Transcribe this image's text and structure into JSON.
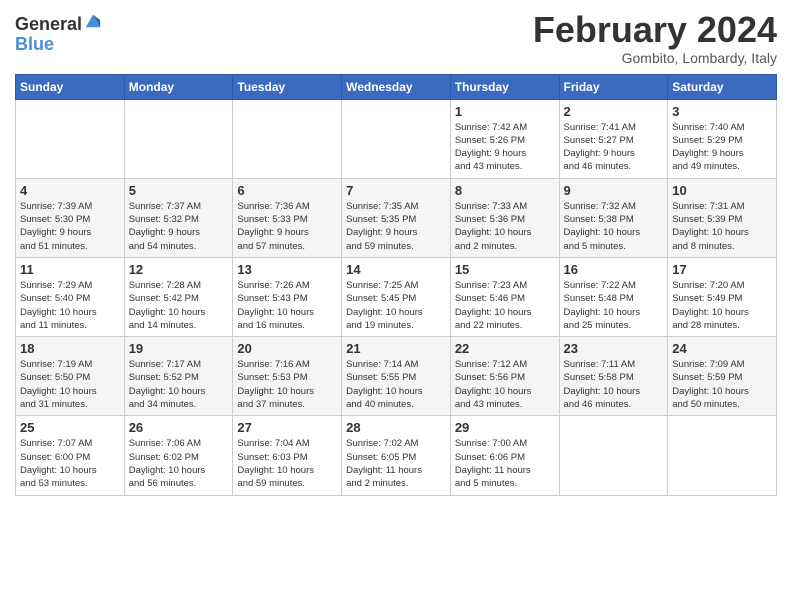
{
  "header": {
    "logo_line1": "General",
    "logo_line2": "Blue",
    "month": "February 2024",
    "location": "Gombito, Lombardy, Italy"
  },
  "days_of_week": [
    "Sunday",
    "Monday",
    "Tuesday",
    "Wednesday",
    "Thursday",
    "Friday",
    "Saturday"
  ],
  "weeks": [
    [
      {
        "day": "",
        "info": ""
      },
      {
        "day": "",
        "info": ""
      },
      {
        "day": "",
        "info": ""
      },
      {
        "day": "",
        "info": ""
      },
      {
        "day": "1",
        "info": "Sunrise: 7:42 AM\nSunset: 5:26 PM\nDaylight: 9 hours\nand 43 minutes."
      },
      {
        "day": "2",
        "info": "Sunrise: 7:41 AM\nSunset: 5:27 PM\nDaylight: 9 hours\nand 46 minutes."
      },
      {
        "day": "3",
        "info": "Sunrise: 7:40 AM\nSunset: 5:29 PM\nDaylight: 9 hours\nand 49 minutes."
      }
    ],
    [
      {
        "day": "4",
        "info": "Sunrise: 7:39 AM\nSunset: 5:30 PM\nDaylight: 9 hours\nand 51 minutes."
      },
      {
        "day": "5",
        "info": "Sunrise: 7:37 AM\nSunset: 5:32 PM\nDaylight: 9 hours\nand 54 minutes."
      },
      {
        "day": "6",
        "info": "Sunrise: 7:36 AM\nSunset: 5:33 PM\nDaylight: 9 hours\nand 57 minutes."
      },
      {
        "day": "7",
        "info": "Sunrise: 7:35 AM\nSunset: 5:35 PM\nDaylight: 9 hours\nand 59 minutes."
      },
      {
        "day": "8",
        "info": "Sunrise: 7:33 AM\nSunset: 5:36 PM\nDaylight: 10 hours\nand 2 minutes."
      },
      {
        "day": "9",
        "info": "Sunrise: 7:32 AM\nSunset: 5:38 PM\nDaylight: 10 hours\nand 5 minutes."
      },
      {
        "day": "10",
        "info": "Sunrise: 7:31 AM\nSunset: 5:39 PM\nDaylight: 10 hours\nand 8 minutes."
      }
    ],
    [
      {
        "day": "11",
        "info": "Sunrise: 7:29 AM\nSunset: 5:40 PM\nDaylight: 10 hours\nand 11 minutes."
      },
      {
        "day": "12",
        "info": "Sunrise: 7:28 AM\nSunset: 5:42 PM\nDaylight: 10 hours\nand 14 minutes."
      },
      {
        "day": "13",
        "info": "Sunrise: 7:26 AM\nSunset: 5:43 PM\nDaylight: 10 hours\nand 16 minutes."
      },
      {
        "day": "14",
        "info": "Sunrise: 7:25 AM\nSunset: 5:45 PM\nDaylight: 10 hours\nand 19 minutes."
      },
      {
        "day": "15",
        "info": "Sunrise: 7:23 AM\nSunset: 5:46 PM\nDaylight: 10 hours\nand 22 minutes."
      },
      {
        "day": "16",
        "info": "Sunrise: 7:22 AM\nSunset: 5:48 PM\nDaylight: 10 hours\nand 25 minutes."
      },
      {
        "day": "17",
        "info": "Sunrise: 7:20 AM\nSunset: 5:49 PM\nDaylight: 10 hours\nand 28 minutes."
      }
    ],
    [
      {
        "day": "18",
        "info": "Sunrise: 7:19 AM\nSunset: 5:50 PM\nDaylight: 10 hours\nand 31 minutes."
      },
      {
        "day": "19",
        "info": "Sunrise: 7:17 AM\nSunset: 5:52 PM\nDaylight: 10 hours\nand 34 minutes."
      },
      {
        "day": "20",
        "info": "Sunrise: 7:16 AM\nSunset: 5:53 PM\nDaylight: 10 hours\nand 37 minutes."
      },
      {
        "day": "21",
        "info": "Sunrise: 7:14 AM\nSunset: 5:55 PM\nDaylight: 10 hours\nand 40 minutes."
      },
      {
        "day": "22",
        "info": "Sunrise: 7:12 AM\nSunset: 5:56 PM\nDaylight: 10 hours\nand 43 minutes."
      },
      {
        "day": "23",
        "info": "Sunrise: 7:11 AM\nSunset: 5:58 PM\nDaylight: 10 hours\nand 46 minutes."
      },
      {
        "day": "24",
        "info": "Sunrise: 7:09 AM\nSunset: 5:59 PM\nDaylight: 10 hours\nand 50 minutes."
      }
    ],
    [
      {
        "day": "25",
        "info": "Sunrise: 7:07 AM\nSunset: 6:00 PM\nDaylight: 10 hours\nand 53 minutes."
      },
      {
        "day": "26",
        "info": "Sunrise: 7:06 AM\nSunset: 6:02 PM\nDaylight: 10 hours\nand 56 minutes."
      },
      {
        "day": "27",
        "info": "Sunrise: 7:04 AM\nSunset: 6:03 PM\nDaylight: 10 hours\nand 59 minutes."
      },
      {
        "day": "28",
        "info": "Sunrise: 7:02 AM\nSunset: 6:05 PM\nDaylight: 11 hours\nand 2 minutes."
      },
      {
        "day": "29",
        "info": "Sunrise: 7:00 AM\nSunset: 6:06 PM\nDaylight: 11 hours\nand 5 minutes."
      },
      {
        "day": "",
        "info": ""
      },
      {
        "day": "",
        "info": ""
      }
    ]
  ]
}
